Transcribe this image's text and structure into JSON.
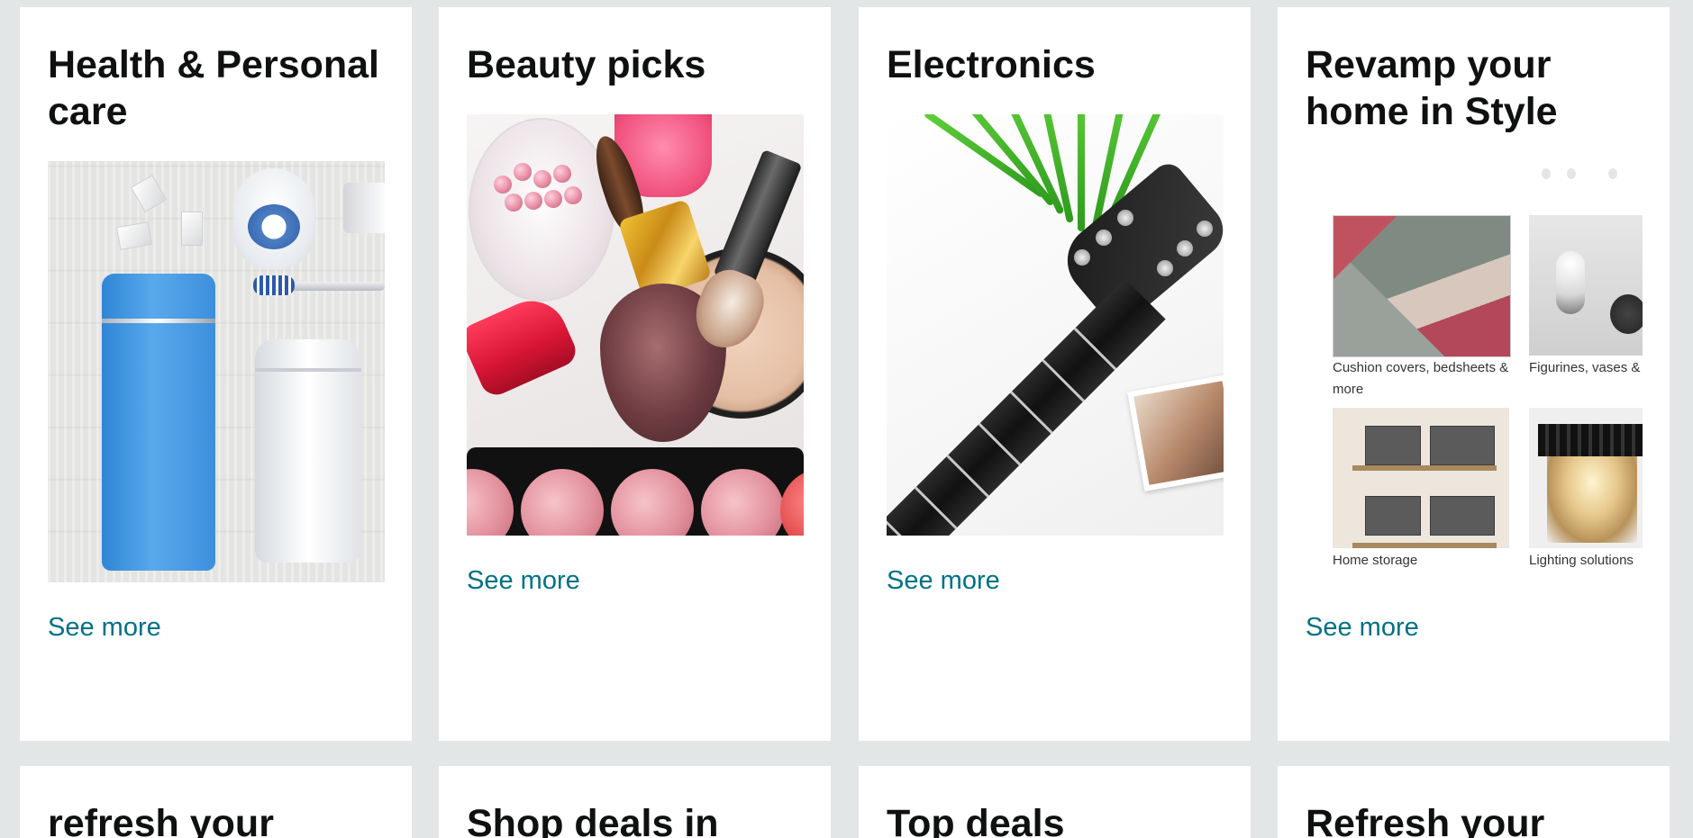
{
  "cards": [
    {
      "title": "Health & Personal care",
      "link": "See more",
      "image_icon": "health-personal-care-products-image"
    },
    {
      "title": "Beauty picks",
      "link": "See more",
      "image_icon": "makeup-products-image"
    },
    {
      "title": "Electronics",
      "link": "See more",
      "image_icon": "electric-guitar-image"
    },
    {
      "title": "Revamp your home in Style",
      "link": "See more",
      "image_icon": "home-decor-collage-image",
      "tiles": [
        {
          "caption": "Cushion covers, bedsheets & more"
        },
        {
          "caption": "Figurines, vases &"
        },
        {
          "caption": "Home storage"
        },
        {
          "caption": "Lighting solutions"
        }
      ]
    }
  ],
  "row2_cards": [
    {
      "title": "refresh your"
    },
    {
      "title": "Shop deals in"
    },
    {
      "title": "Top deals"
    },
    {
      "title": "Refresh your"
    }
  ],
  "colors": {
    "page_background": "#e3e6e6",
    "card_background": "#ffffff",
    "title_text": "#0f1111",
    "link_text": "#007185"
  }
}
